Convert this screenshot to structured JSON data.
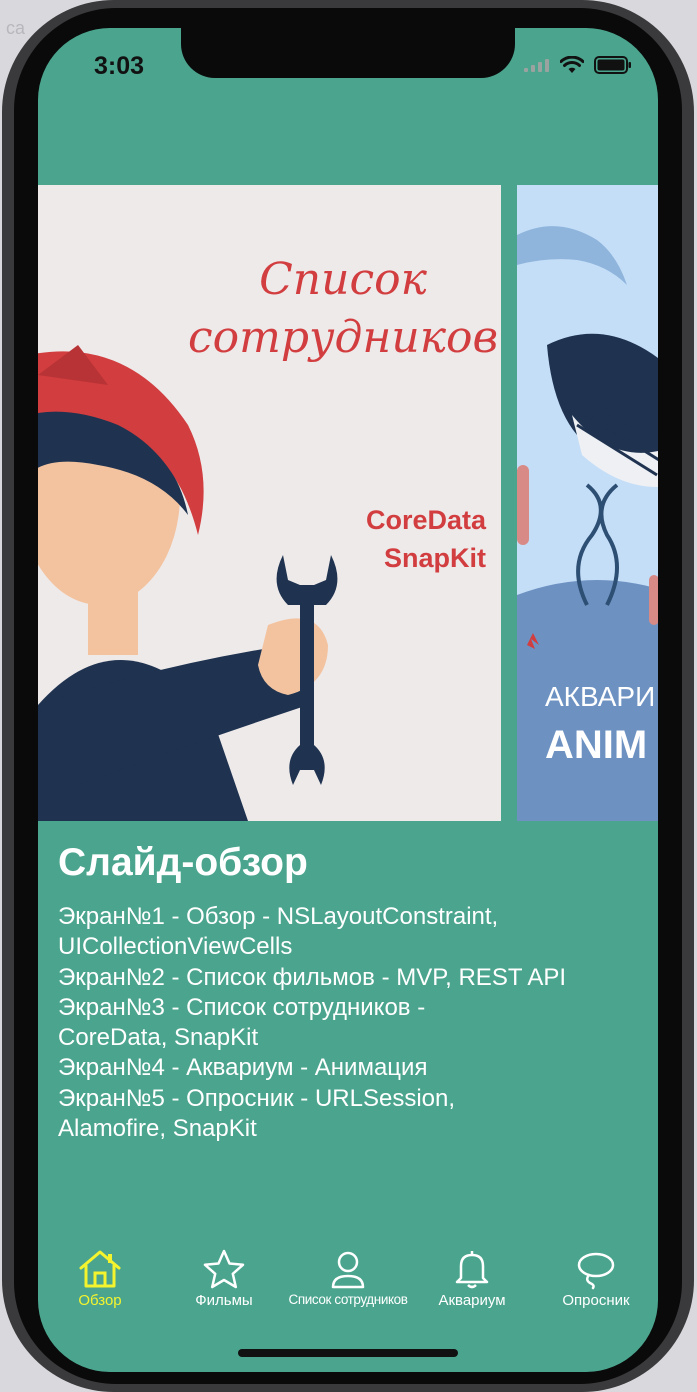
{
  "desktop": {
    "hint_text": "ca"
  },
  "status_bar": {
    "time": "3:03"
  },
  "carousel": {
    "slides": [
      {
        "title": "Список сотрудников",
        "subtitle_line1": "CoreData",
        "subtitle_line2": "SnapKit"
      },
      {
        "text_line1": "АКВАРИ",
        "text_line2": "ANIM"
      }
    ]
  },
  "section": {
    "title": "Слайд-обзор",
    "lines": [
      "Экран№1 - Обзор - NSLayoutConstraint,",
      "UICollectionViewCells",
      "Экран№2 - Список фильмов - MVP, REST API",
      "Экран№3 - Список сотрудников -",
      "CoreData, SnapKit",
      "Экран№4 - Аквариум - Анимация",
      "Экран№5 - Опросник - URLSession,",
      "Alamofire, SnapKit"
    ]
  },
  "tabbar": {
    "active_index": 0,
    "items": [
      {
        "label": "Обзор",
        "icon": "house-icon"
      },
      {
        "label": "Фильмы",
        "icon": "star-icon"
      },
      {
        "label": "Список сотрудников",
        "icon": "person-icon"
      },
      {
        "label": "Аквариум",
        "icon": "bell-icon"
      },
      {
        "label": "Опросник",
        "icon": "lasso-icon"
      }
    ]
  },
  "colors": {
    "background": "#4ba58e",
    "active_tab": "#f4f42e",
    "text": "#ffffff",
    "slide_accent": "#d23d3f",
    "slide2_background": "#c5def8"
  }
}
